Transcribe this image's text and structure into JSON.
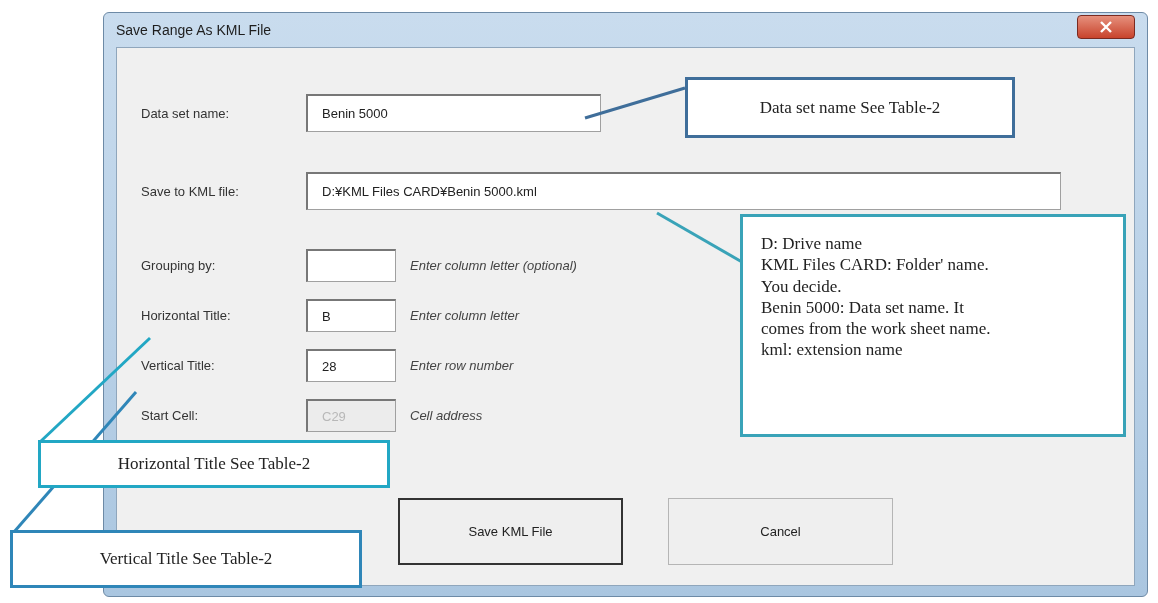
{
  "window": {
    "title": "Save Range As KML File"
  },
  "fields": [
    {
      "kind": "name",
      "label": "Data set name:",
      "value": "Benin 5000",
      "disabled": false
    },
    {
      "kind": "path",
      "label": "Save to KML file:",
      "value": "D:¥KML Files CARD¥Benin 5000.kml",
      "disabled": false
    },
    {
      "kind": "short",
      "label": "Grouping by:",
      "hint": "Enter column letter (optional)",
      "disabled": false
    },
    {
      "kind": "short",
      "label": "Horizontal Title:",
      "value": "B",
      "hint": "Enter column letter",
      "disabled": false
    },
    {
      "kind": "short",
      "label": "Vertical Title:",
      "value": "28",
      "hint": "Enter row number",
      "disabled": false
    },
    {
      "kind": "short",
      "label": "Start Cell:",
      "value": "C29",
      "hint": "Cell address",
      "disabled": true
    }
  ],
  "buttons": [
    {
      "label": "Save KML File",
      "default": true
    },
    {
      "label": "Cancel",
      "default": false
    }
  ],
  "callouts": [
    {
      "lines": [
        "Data set name See Table-2"
      ]
    },
    {
      "lines": [
        "D: Drive name",
        "KML Files CARD: Folder' name.",
        "You decide.",
        "Benin 5000: Data set name. It",
        "comes from the work sheet name.",
        "kml:    extension name"
      ]
    },
    {
      "lines": [
        "Horizontal Title See Table-2"
      ]
    },
    {
      "lines": [
        "Vertical Title See Table-2"
      ]
    }
  ]
}
